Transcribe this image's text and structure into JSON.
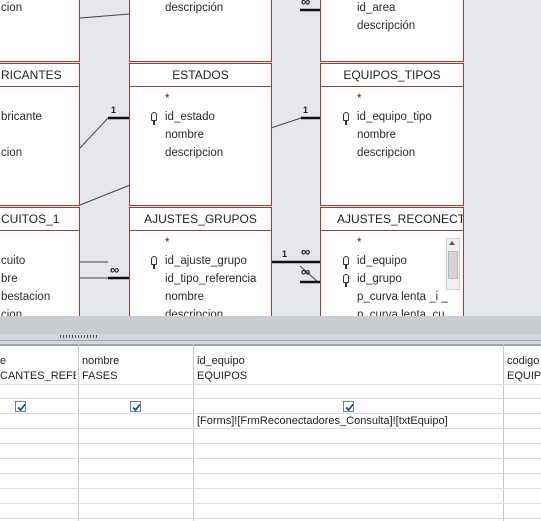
{
  "diagram": {
    "tables": {
      "top_left": {
        "fields": [
          "cion"
        ]
      },
      "top_mid": {
        "fields": [
          "descripción"
        ]
      },
      "top_right": {
        "fields": [
          "id_area",
          "descripción"
        ]
      },
      "fabricantes": {
        "title": "RICANTES",
        "fields": [
          "bricante",
          "cion"
        ]
      },
      "estados": {
        "title": "ESTADOS",
        "fields": [
          "*",
          "id_estado",
          "nombre",
          "descripcion"
        ]
      },
      "equipos_tipos": {
        "title": "EQUIPOS_TIPOS",
        "fields": [
          "*",
          "id_equipo_tipo",
          "nombre",
          "descripcion"
        ]
      },
      "circuitos": {
        "title": "CUITOS_1",
        "fields": [
          "cuito",
          "bre",
          "bestacion",
          "cion"
        ]
      },
      "ajustes_grupos": {
        "title": "AJUSTES_GRUPOS",
        "fields": [
          "*",
          "id_ajuste_grupo",
          "id_tipo_referencia",
          "nombre",
          "descripcion"
        ]
      },
      "ajustes_reconect": {
        "title": "AJUSTES_RECONECT...",
        "fields": [
          "*",
          "id_equipo",
          "id_grupo",
          "p_curva lenta _i _",
          "p_curva lenta_cu"
        ]
      }
    },
    "relation_labels": {
      "one": "1",
      "many": "∞"
    }
  },
  "qbe": {
    "columns": [
      {
        "field": "e",
        "table": "CANTES_REFERE",
        "show": true,
        "criteria": ""
      },
      {
        "field": "nombre",
        "table": "FASES",
        "show": true,
        "criteria": ""
      },
      {
        "field": "id_equipo",
        "table": "EQUIPOS",
        "show": true,
        "criteria": "[Forms]![FrmReconectadores_Consulta]![txtEquipo]"
      },
      {
        "field": "codigo",
        "table": "EQUIPO",
        "show": false,
        "criteria": ""
      }
    ]
  },
  "colors": {
    "table_border": "#a4373a",
    "canvas": "#e5e7eb"
  }
}
